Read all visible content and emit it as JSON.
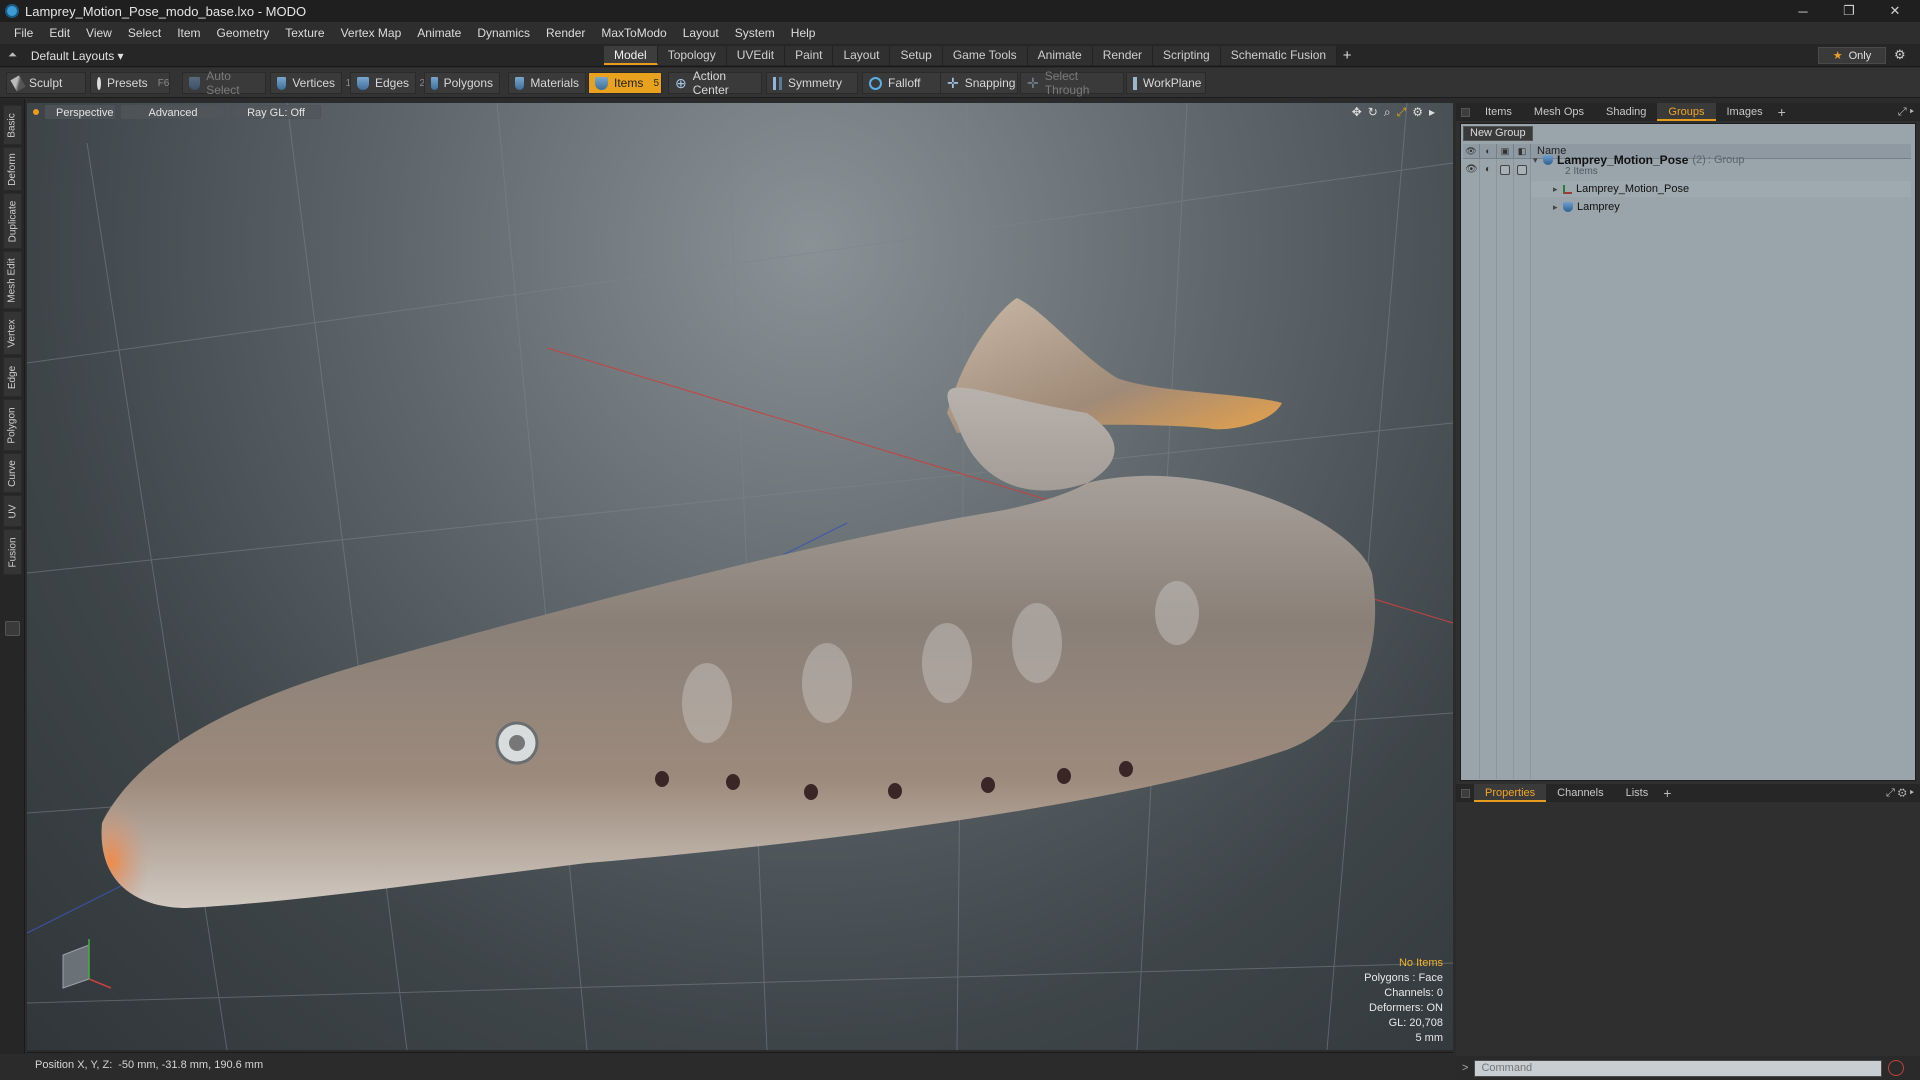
{
  "window": {
    "title": "Lamprey_Motion_Pose_modo_base.lxo - MODO",
    "controls": [
      "─",
      "❐",
      "✕"
    ]
  },
  "menu": [
    "File",
    "Edit",
    "View",
    "Select",
    "Item",
    "Geometry",
    "Texture",
    "Vertex Map",
    "Animate",
    "Dynamics",
    "Render",
    "MaxToModo",
    "Layout",
    "System",
    "Help"
  ],
  "layout_selector": "Default Layouts ▾",
  "tabs": [
    "Model",
    "Topology",
    "UVEdit",
    "Paint",
    "Layout",
    "Setup",
    "Game Tools",
    "Animate",
    "Render",
    "Scripting",
    "Schematic Fusion"
  ],
  "active_tab": "Model",
  "only_button": "Only",
  "toolbar": {
    "sculpt": "Sculpt",
    "presets": "Presets",
    "presets_key": "F6",
    "auto_select": "Auto Select",
    "vertices": "Vertices",
    "vertices_count": "1",
    "edges": "Edges",
    "edges_count": "2",
    "polygons": "Polygons",
    "materials": "Materials",
    "items": "Items",
    "items_count": "5",
    "action_center": "Action Center",
    "symmetry": "Symmetry",
    "falloff": "Falloff",
    "snapping": "Snapping",
    "select_through": "Select Through",
    "workplane": "WorkPlane"
  },
  "left_tabs": [
    "Basic",
    "Deform",
    "Duplicate",
    "Mesh Edit",
    "Vertex",
    "Edge",
    "Polygon",
    "Curve",
    "UV",
    "Fusion"
  ],
  "viewport": {
    "perspective": "Perspective",
    "advanced": "Advanced",
    "raygl": "Ray GL: Off",
    "info": {
      "no_items": "No Items",
      "polygons": "Polygons : Face",
      "channels": "Channels: 0",
      "deformers": "Deformers: ON",
      "gl": "GL: 20,708",
      "scale": "5 mm"
    }
  },
  "status": {
    "label": "Position X, Y, Z:",
    "value": "-50 mm, -31.8 mm, 190.6 mm"
  },
  "panel_tabs": [
    "Items",
    "Mesh Ops",
    "Shading",
    "Groups",
    "Images"
  ],
  "active_panel_tab": "Groups",
  "groups": {
    "new_group": "New Group",
    "name_header": "Name",
    "root": {
      "name": "Lamprey_Motion_Pose",
      "count": "(2)",
      "type": ": Group",
      "sub": "2 Items"
    },
    "children": [
      "Lamprey_Motion_Pose",
      "Lamprey"
    ]
  },
  "bottom_tabs": [
    "Properties",
    "Channels",
    "Lists"
  ],
  "active_bottom_tab": "Properties",
  "command_placeholder": "Command",
  "colors": {
    "accent": "#e89c1c",
    "viewport_bg": "#5e666b",
    "panel_bg": "#99a4ab"
  }
}
